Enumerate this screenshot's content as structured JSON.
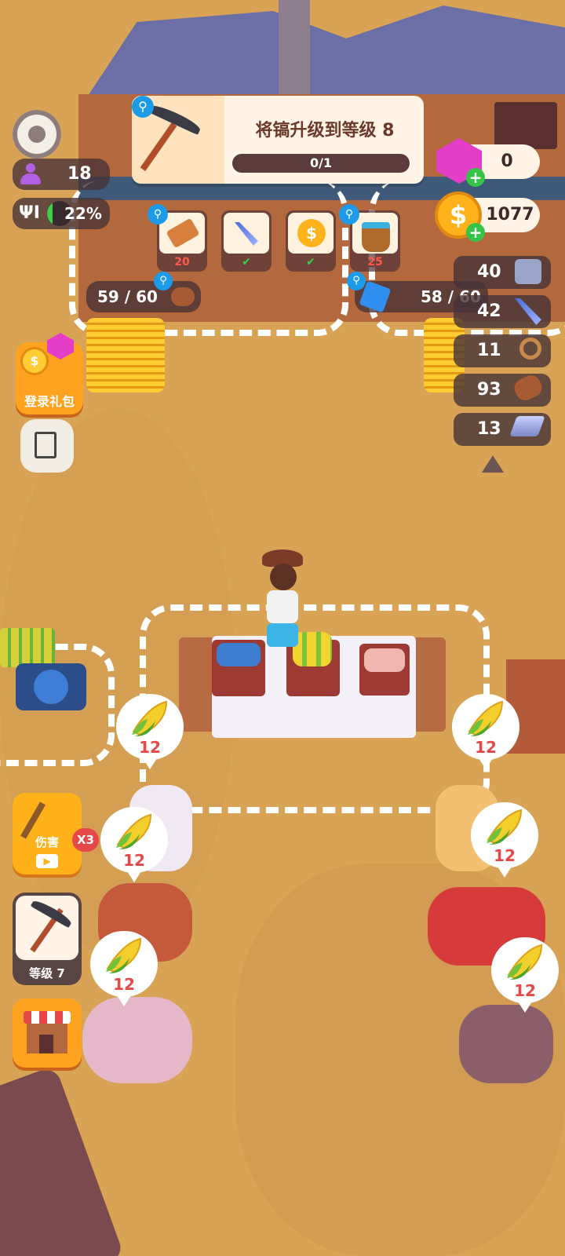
{
  "top_stats": {
    "population": "18",
    "food_percent": "22%",
    "food_level": 0.22
  },
  "quest": {
    "title": "将镐升级到等级 8",
    "progress_text": "0/1",
    "progress": 0.0
  },
  "currency": {
    "gems": "0",
    "coins": "1077"
  },
  "build_slots": [
    {
      "item": "wood-plank",
      "label": "20",
      "done": false
    },
    {
      "item": "nails",
      "label": "",
      "done": true
    },
    {
      "item": "coin",
      "label": "",
      "done": true
    },
    {
      "item": "water-bucket",
      "label": "25",
      "done": false
    }
  ],
  "storage_left": {
    "count": "59 / 60"
  },
  "storage_right": {
    "count": "58 / 60"
  },
  "resources": [
    {
      "value": "40",
      "icon": "iron-block-icon"
    },
    {
      "value": "42",
      "icon": "nails-icon"
    },
    {
      "value": "11",
      "icon": "rope-icon"
    },
    {
      "value": "93",
      "icon": "log-icon"
    },
    {
      "value": "13",
      "icon": "metal-bar-icon"
    }
  ],
  "left_menu": {
    "login_gift": "登录礼包",
    "damage_label": "伤害",
    "damage_mult": "X3",
    "pickaxe_level": "等级 7"
  },
  "customer_requests": [
    {
      "item": "corn",
      "count": "12"
    },
    {
      "item": "corn",
      "count": "12"
    },
    {
      "item": "corn",
      "count": "12"
    },
    {
      "item": "corn",
      "count": "12"
    },
    {
      "item": "corn",
      "count": "12"
    },
    {
      "item": "corn",
      "count": "12"
    }
  ],
  "colors": {
    "ground": "#d9a356",
    "accent_gold": "#ffb21a",
    "panel_dark": "#463237",
    "request_red": "#e64848"
  }
}
